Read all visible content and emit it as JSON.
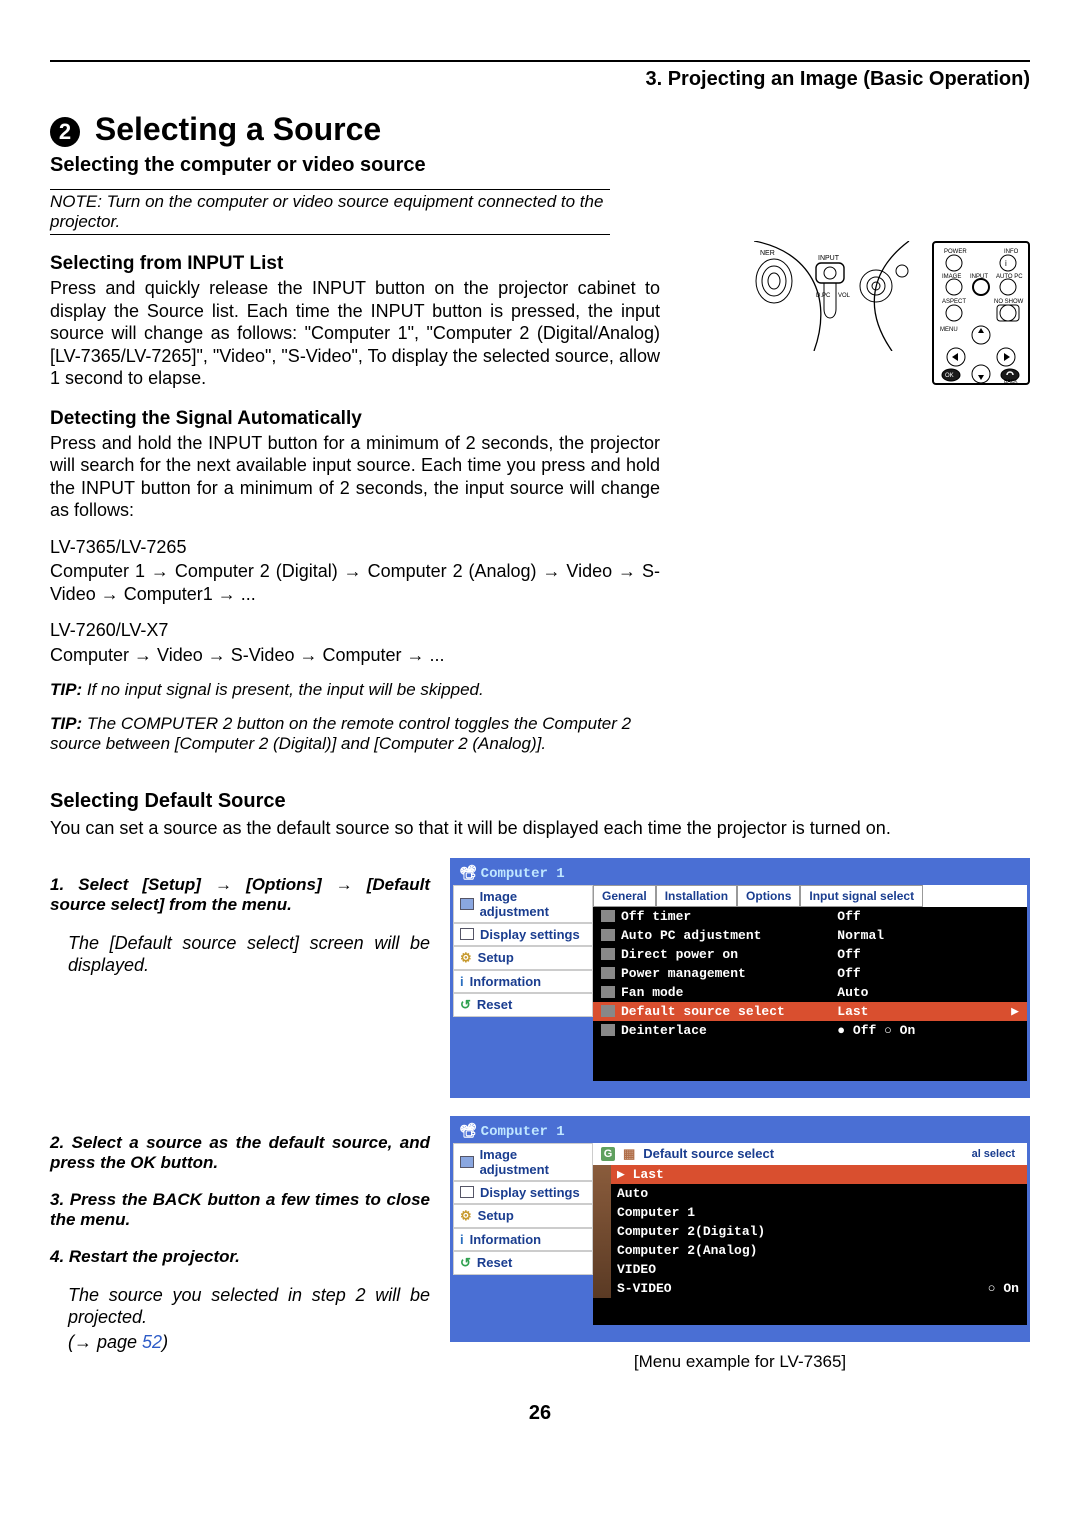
{
  "header": {
    "chapter": "3. Projecting an Image (Basic Operation)"
  },
  "title": {
    "number": "2",
    "text": "Selecting a Source"
  },
  "subtitle": "Selecting the computer or video source",
  "note": "NOTE: Turn on the computer or video source equipment connected to the projector.",
  "sec1": {
    "heading": "Selecting from INPUT List",
    "body": "Press and quickly release the INPUT button on the projector cabinet to display the Source list. Each time the INPUT button is pressed, the input source will change as follows: \"Computer 1\", \"Computer 2 (Digital/Analog) [LV-7365/LV-7265]\", \"Video\", \"S-Video\", To display the selected source, allow 1 second to elapse."
  },
  "sec2": {
    "heading": "Detecting the Signal Automatically",
    "body": "Press and hold the INPUT button for a minimum of 2 seconds, the projector will search for the next available input source. Each time you press and hold the INPUT button for a minimum of 2 seconds, the input source will change as follows:",
    "model1": "LV-7365/LV-7265",
    "chain1": "Computer 1 → Computer 2 (Digital) → Computer 2 (Analog) → Video → S-Video → Computer1 → ...",
    "model2": "LV-7260/LV-X7",
    "chain2": "Computer → Video → S-Video → Computer → ..."
  },
  "tip1": {
    "label": "TIP:",
    "text": " If no input signal is present, the input will be skipped."
  },
  "tip2": {
    "label": "TIP:",
    "text": " The COMPUTER 2 button on the remote control toggles the Computer 2 source between [Computer 2 (Digital)] and [Computer 2 (Analog)]."
  },
  "sec3": {
    "heading": "Selecting Default Source",
    "intro": "You can set a source as the default source so that it will be displayed each time the projector is turned on.",
    "step1": "Select [Setup] → [Options] → [Default source select] from the menu.",
    "step1_sub": "The [Default source select] screen will be displayed.",
    "step2": "Select a source as the default source, and press the OK button.",
    "step3": "Press the BACK button a few times to close the menu.",
    "step4": "Restart the projector.",
    "step4_sub": "The source you selected in step 2 will be projected.",
    "pageref_prefix": "(→ page ",
    "pageref_num": "52",
    "pageref_suffix": ")"
  },
  "menu1": {
    "title": "Computer 1",
    "sidebar": [
      "Image adjustment",
      "Display settings",
      "Setup",
      "Information",
      "Reset"
    ],
    "tabs": [
      "General",
      "Installation",
      "Options",
      "Input signal select"
    ],
    "rows": [
      {
        "label": "Off timer",
        "value": "Off"
      },
      {
        "label": "Auto PC adjustment",
        "value": "Normal"
      },
      {
        "label": "Direct power on",
        "value": "Off"
      },
      {
        "label": "Power management",
        "value": "Off"
      },
      {
        "label": "Fan mode",
        "value": "Auto"
      },
      {
        "label": "Default source select",
        "value": "Last",
        "hl": true
      },
      {
        "label": "Deinterlace",
        "value": "● Off       ○ On"
      }
    ]
  },
  "menu2": {
    "title": "Computer 1",
    "sidebar": [
      "Image adjustment",
      "Display settings",
      "Setup",
      "Information",
      "Reset"
    ],
    "header_right": "al select",
    "panel_title": "Default source select",
    "items": [
      "Last",
      "Auto",
      "Computer 1",
      "Computer 2(Digital)",
      "Computer 2(Analog)",
      "VIDEO",
      "S-VIDEO"
    ],
    "selected": "Last",
    "trail": "○ On"
  },
  "panel_labels": {
    "input": "INPUT",
    "dpc": "D.PC",
    "vol": "VOL",
    "ner": "NER",
    "power": "POWER",
    "info": "INFO",
    "image": "IMAGE",
    "autopc": "AUTO PC",
    "aspect": "ASPECT",
    "noshow": "NO SHOW",
    "menu": "MENU",
    "ok": "OK",
    "back": "BACK"
  },
  "caption": "[Menu example for LV-7365]",
  "pagenum": "26"
}
